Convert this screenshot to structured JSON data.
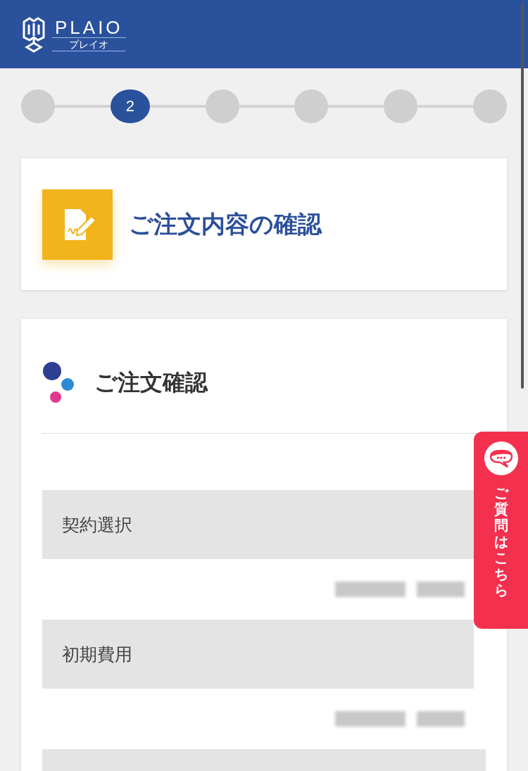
{
  "header": {
    "logo": "PLAIO",
    "logo_sub": "プレイオ"
  },
  "steps": [
    {
      "selected": false
    },
    {
      "label": "2",
      "selected": true
    },
    {
      "selected": false
    },
    {
      "selected": false
    },
    {
      "selected": false
    },
    {
      "selected": false
    }
  ],
  "page_title": "ご注文内容の確認",
  "section": {
    "title": "ご注文確認",
    "rows": [
      {
        "label": "契約選択",
        "value_hidden": true
      },
      {
        "label": "初期費用",
        "value_hidden": true
      }
    ]
  },
  "question_tab": {
    "label": "ご質問はこちら"
  }
}
